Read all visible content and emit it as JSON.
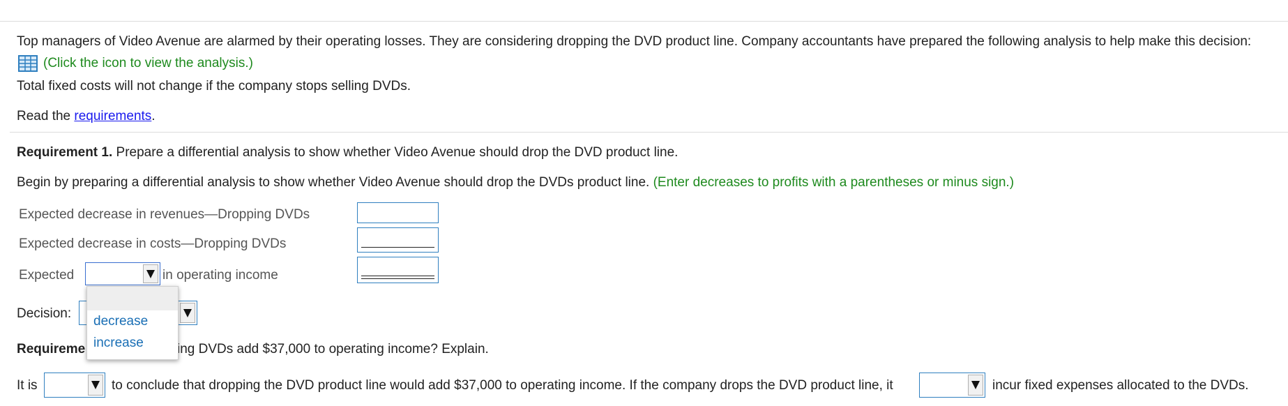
{
  "intro": {
    "text": "Top managers of Video Avenue are alarmed by their operating losses. They are considering dropping the DVD product line. Company accountants have prepared the following analysis to help make this decision:",
    "click_icon_text": "(Click the icon to view the analysis.)",
    "fixed_costs_text": "Total fixed costs will not change if the company stops selling DVDs.",
    "read_the": "Read the",
    "requirements_link": "requirements",
    "period": "."
  },
  "req1": {
    "label": "Requirement 1.",
    "text": "Prepare a differential analysis to show whether Video Avenue should drop the DVD product line.",
    "instruction": "Begin by preparing a differential analysis to show whether Video Avenue should drop the DVDs product line.",
    "hint": "(Enter decreases to profits with a parentheses or minus sign.)",
    "row1_label": "Expected decrease in revenues—Dropping DVDs",
    "row1_value": "",
    "row2_label": "Expected decrease in costs—Dropping DVDs",
    "row2_value": "",
    "row3_prefix": "Expected",
    "row3_selected": "",
    "row3_suffix": "in operating income",
    "row3_value": "",
    "dropdown_options": [
      "decrease",
      "increase"
    ],
    "decision_label": "Decision:",
    "decision_selected": ""
  },
  "req2": {
    "label_visible": "Requireme",
    "text_visible": "ing DVDs add $37,000 to operating income? Explain.",
    "it_is": "It is",
    "dropdown1_selected": "",
    "middle_text": "to conclude that dropping the DVD product line would add $37,000 to operating income. If the company drops the DVD product line, it",
    "dropdown2_selected": "",
    "end_text": "incur fixed expenses allocated to the DVDs."
  }
}
